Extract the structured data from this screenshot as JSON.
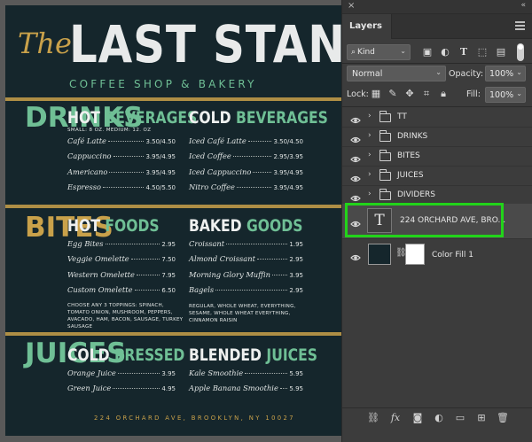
{
  "menu": {
    "title_the": "The",
    "title_main": "LAST STAND",
    "subtitle": "COFFEE SHOP & BAKERY",
    "sections": {
      "drinks": {
        "side": "DRINKS",
        "left": {
          "title_a": "HOT ",
          "title_b": "BEVERAGES",
          "note": "SMALL: 8 OZ. MEDIUM: 12. OZ",
          "items": [
            {
              "name": "Café Latte",
              "price": "3.50/4.50"
            },
            {
              "name": "Cappuccino",
              "price": "3.95/4.95"
            },
            {
              "name": "Americano",
              "price": "3.95/4.95"
            },
            {
              "name": "Espresso",
              "price": "4.50/5.50"
            }
          ]
        },
        "right": {
          "title_a": "COLD ",
          "title_b": "BEVERAGES",
          "items": [
            {
              "name": "Iced Café Latte",
              "price": "3.50/4.50"
            },
            {
              "name": "Iced Coffee",
              "price": "2.95/3.95"
            },
            {
              "name": "Iced Cappuccino",
              "price": "3.95/4.95"
            },
            {
              "name": "Nitro Coffee",
              "price": "3.95/4.95"
            }
          ]
        }
      },
      "bites": {
        "side": "BITES",
        "left": {
          "title_a": "HOT ",
          "title_b": "FOODS",
          "items": [
            {
              "name": "Egg Bites",
              "price": "2.95"
            },
            {
              "name": "Veggie Omelette",
              "price": "7.50"
            },
            {
              "name": "Western Omelette",
              "price": "7.95"
            },
            {
              "name": "Custom Omelette",
              "price": "6.50"
            }
          ],
          "note": "CHOOSE ANY 3 TOPPINGS: SPINACH, TOMATO ONION, MUSHROOM, PEPPERS, AVACADO, HAM, BACON, SAUSAGE, TURKEY SAUSAGE"
        },
        "right": {
          "title_a": "BAKED ",
          "title_b": "GOODS",
          "items": [
            {
              "name": "Croissant",
              "price": "1.95"
            },
            {
              "name": "Almond Croissant",
              "price": "2.95"
            },
            {
              "name": "Morning Glory Muffin",
              "price": "3.95"
            },
            {
              "name": "Bagels",
              "price": "2.95"
            }
          ],
          "note": "REGULAR, WHOLE WHEAT, EVERYTHING, SESAME, WHOLE WHEAT EVERYTHING, CINNAMON RAISIN"
        }
      },
      "juices": {
        "side": "JUICES",
        "left": {
          "title_a": "COLD ",
          "title_b": "PRESSED",
          "items": [
            {
              "name": "Orange Juice",
              "price": "3.95"
            },
            {
              "name": "Green Juice",
              "price": "4.95"
            }
          ]
        },
        "right": {
          "title_a": "BLENDED ",
          "title_b": "JUICES",
          "items": [
            {
              "name": "Kale Smoothie",
              "price": "5.95"
            },
            {
              "name": "Apple Banana Smoothie",
              "price": "5.95"
            }
          ]
        }
      }
    },
    "address": "224 ORCHARD AVE, BROOKLYN, NY 10027"
  },
  "panel": {
    "close": "×",
    "collapse": "«",
    "tab": "Layers",
    "filter_kind": "Kind",
    "blend_mode": "Normal",
    "opacity_label": "Opacity:",
    "opacity_value": "100%",
    "lock_label": "Lock:",
    "fill_label": "Fill:",
    "fill_value": "100%",
    "layers": [
      {
        "name": "TT"
      },
      {
        "name": "DRINKS"
      },
      {
        "name": "BITES"
      },
      {
        "name": "JUICES"
      },
      {
        "name": "DIVIDERS"
      }
    ],
    "text_layer": {
      "thumb": "T",
      "name": "224 ORCHARD AVE, BRO..."
    },
    "fill_layer": {
      "name": "Color Fill 1"
    }
  },
  "colors": {
    "accent_green": "#6fbf95",
    "gold": "#c9a14a",
    "menu_bg": "#15262c",
    "highlight": "#22d31a"
  }
}
